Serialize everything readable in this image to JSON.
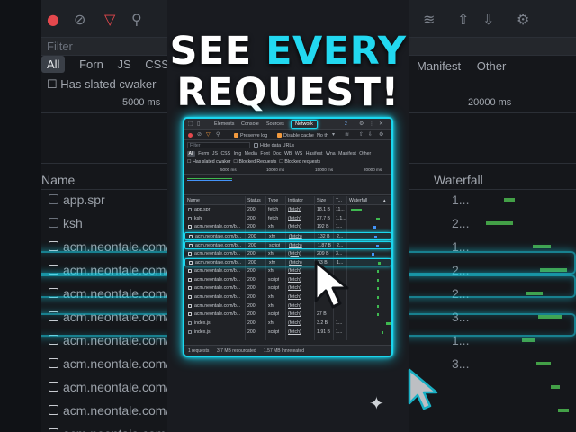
{
  "headline": {
    "line1_pre": "SEE ",
    "line1_accent": "EVERY",
    "line2": "REQUEST!"
  },
  "background": {
    "filter_placeholder": "Filter",
    "types": [
      "All",
      "Forn",
      "JS",
      "CSS",
      "Im"
    ],
    "right_types": [
      "Manifest",
      "Other"
    ],
    "has_slated": "Has slated cwaker",
    "timeline_5000": "5000 ms",
    "timeline_20000": "20000 ms",
    "name_header": "Name",
    "waterfall_header": "Waterfall",
    "rows": [
      {
        "name": "app.spr",
        "num": "1...",
        "checked": false
      },
      {
        "name": "ksh",
        "num": "2...",
        "checked": false
      },
      {
        "name": "acm.neontale.com/b",
        "num": "1...",
        "checked": true
      },
      {
        "name": "acm.neontale.com/b",
        "num": "2...",
        "checked": true
      },
      {
        "name": "acm.neontale.com/b",
        "num": "2...",
        "checked": true
      },
      {
        "name": "acm.neontale.com/b",
        "num": "3...",
        "checked": true
      },
      {
        "name": "acm.neontale.com/b",
        "num": "1...",
        "checked": true
      },
      {
        "name": "acm.neontale.com/b",
        "num": "3...",
        "checked": true
      },
      {
        "name": "acm.neontale.com/b",
        "num": "",
        "checked": true
      },
      {
        "name": "acm.neontale.com/b",
        "num": "",
        "checked": true
      },
      {
        "name": "acm.neontale.com/b",
        "num": "",
        "checked": true
      }
    ]
  },
  "panel": {
    "tabs": {
      "elements": "Elements",
      "console": "Console",
      "sources": "Sources",
      "network": "Network",
      "badge": "2"
    },
    "toolbar": {
      "preserve_log": "Preserve log",
      "disable_cache": "Disable cache",
      "throttle": "No th"
    },
    "filter_placeholder": "Filter",
    "hide_data_urls": "Hide data URLs",
    "types": [
      "All",
      "Form",
      "JS",
      "CSS",
      "Img",
      "Media",
      "Font",
      "Doc",
      "WB",
      "WS",
      "Hasifest",
      "Wna",
      "Manifest",
      "Other"
    ],
    "has_slated": "Has slated cwaker",
    "blocked_requests": "Blocked Requests",
    "blocked_requests2": "Blocked requests",
    "timeline": [
      "5000 ms",
      "10000 ms",
      "15000 ms",
      "20000 ms"
    ],
    "columns": {
      "name": "Name",
      "status": "Status",
      "type": "Type",
      "initiator": "Initiator",
      "size": "Size",
      "time": "T...",
      "waterfall": "Waterfall"
    },
    "rows": [
      {
        "name": "app.spr",
        "status": "200",
        "type": "fetch",
        "initiator": "(fetch)",
        "size": "18.1 B",
        "time": "11...",
        "checked": false,
        "hl": false
      },
      {
        "name": "ksh",
        "status": "200",
        "type": "fetch",
        "initiator": "(fetch)",
        "size": "27.7 B",
        "time": "1.1...",
        "checked": false,
        "hl": false
      },
      {
        "name": "acm.neontale.com/b...",
        "status": "200",
        "type": "xhr",
        "initiator": "(fetch)",
        "size": "192 B",
        "time": "1...",
        "checked": true,
        "hl": false
      },
      {
        "name": "acm.neontale.com/b...",
        "status": "200",
        "type": "xhr",
        "initiator": "(fetch)",
        "size": "132 B",
        "time": "2...",
        "checked": true,
        "hl": true
      },
      {
        "name": "acm.neontale.com/b...",
        "status": "200",
        "type": "script",
        "initiator": "(fetch)",
        "size": "1.87 B",
        "time": "2...",
        "checked": true,
        "hl": true
      },
      {
        "name": "acm.neontale.com/b...",
        "status": "200",
        "type": "xhr",
        "initiator": "(fetch)",
        "size": "209 B",
        "time": "3...",
        "checked": true,
        "hl": false
      },
      {
        "name": "acm.neontale.com/b...",
        "status": "200",
        "type": "xhr",
        "initiator": "(fetch)",
        "size": "33 B",
        "time": "1...",
        "checked": true,
        "hl": true
      },
      {
        "name": "acm.neontale.com/b...",
        "status": "200",
        "type": "xhr",
        "initiator": "(fetch)",
        "size": "",
        "time": "",
        "checked": true,
        "hl": false
      },
      {
        "name": "acm.neontale.com/b...",
        "status": "200",
        "type": "script",
        "initiator": "(fetch)",
        "size": "",
        "time": "",
        "checked": true,
        "hl": false
      },
      {
        "name": "acm.neontale.com/b...",
        "status": "200",
        "type": "script",
        "initiator": "(fetch)",
        "size": "",
        "time": "",
        "checked": true,
        "hl": false
      },
      {
        "name": "acm.neontale.com/b...",
        "status": "200",
        "type": "xhr",
        "initiator": "(fetch)",
        "size": "",
        "time": "",
        "checked": true,
        "hl": false
      },
      {
        "name": "acm.neontale.com/b...",
        "status": "200",
        "type": "xhr",
        "initiator": "(fetch)",
        "size": "",
        "time": "",
        "checked": true,
        "hl": false
      },
      {
        "name": "acm.neontale.com/b...",
        "status": "200",
        "type": "script",
        "initiator": "(fetch)",
        "size": "27 B",
        "time": "",
        "checked": true,
        "hl": false
      },
      {
        "name": "index.js",
        "status": "200",
        "type": "xhr",
        "initiator": "(fetch)",
        "size": "3.2 B",
        "time": "1...",
        "checked": false,
        "hl": false
      },
      {
        "name": "index.js",
        "status": "200",
        "type": "script",
        "initiator": "(fetch)",
        "size": "1.91 B",
        "time": "1...",
        "checked": false,
        "hl": false
      }
    ],
    "status": {
      "requests": "1 requests",
      "transferred": "3.7 MB resourcated",
      "resources": "1.57 MB lnnreteated"
    }
  },
  "colors": {
    "accent": "#1bd6ee",
    "headline_accent": "#22d8f0",
    "record": "#e5484d",
    "checkbox_on": "#f29a3e"
  }
}
